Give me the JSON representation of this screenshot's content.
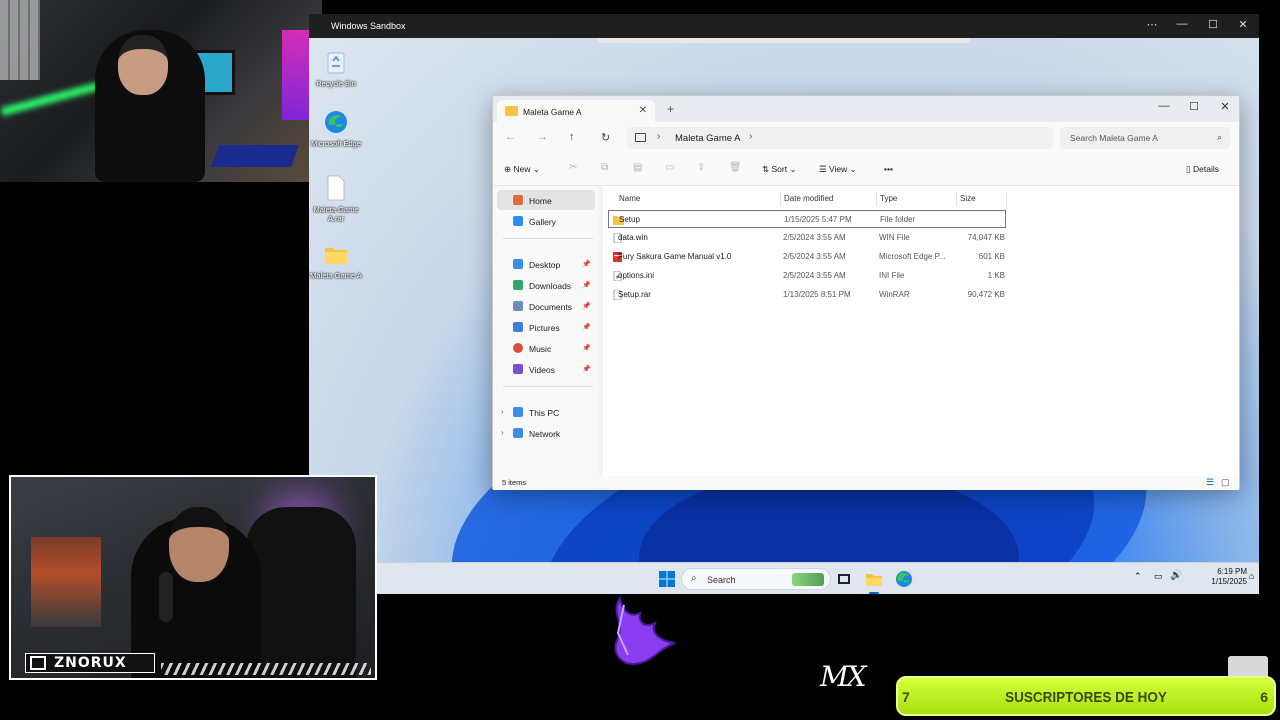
{
  "sandbox": {
    "title": "Windows Sandbox",
    "controls": [
      "⋯",
      "—",
      "☐",
      "✕"
    ]
  },
  "desktop_icons": [
    {
      "label": "Recycle Bin"
    },
    {
      "label": "Microsoft Edge"
    },
    {
      "label": "Maleta Game A.rar"
    },
    {
      "label": "Maleta Game A"
    }
  ],
  "explorer": {
    "tab_title": "Maleta Game A",
    "breadcrumb": "Maleta Game A",
    "search_placeholder": "Search Maleta Game A",
    "commands": {
      "new": "New",
      "sort": "Sort",
      "view": "View",
      "more": "•••",
      "details": "Details"
    },
    "nav": {
      "home": "Home",
      "gallery": "Gallery",
      "quick": [
        "Desktop",
        "Downloads",
        "Documents",
        "Pictures",
        "Music",
        "Videos"
      ],
      "this_pc": "This PC",
      "network": "Network"
    },
    "columns": {
      "name": "Name",
      "date": "Date modified",
      "type": "Type",
      "size": "Size"
    },
    "files": [
      {
        "name": "Setup",
        "date": "1/15/2025 5:47 PM",
        "type": "File folder",
        "size": ""
      },
      {
        "name": "data.win",
        "date": "2/5/2024 3:55 AM",
        "type": "WIN File",
        "size": "74,047 KB"
      },
      {
        "name": "Fury Sakura Game Manual v1.0",
        "date": "2/5/2024 3:55 AM",
        "type": "Microsoft Edge P...",
        "size": "601 KB"
      },
      {
        "name": "options.ini",
        "date": "2/5/2024 3:55 AM",
        "type": "INI File",
        "size": "1 KB"
      },
      {
        "name": "Setup.rar",
        "date": "1/13/2025 8:51 PM",
        "type": "WinRAR",
        "size": "90,472 KB"
      }
    ],
    "status": "5 items"
  },
  "taskbar": {
    "search_label": "Search",
    "time": "6:19 PM",
    "date": "1/15/2025"
  },
  "overlay": {
    "brand": "ZNORUX",
    "signature": "MX",
    "subs_label": "SUSCRIPTORES DE HOY",
    "subs_left": "7",
    "subs_right": "6"
  },
  "colors": {
    "accent": "#0067c0",
    "folder": "#f4c542",
    "subs": "#c8f22a"
  }
}
